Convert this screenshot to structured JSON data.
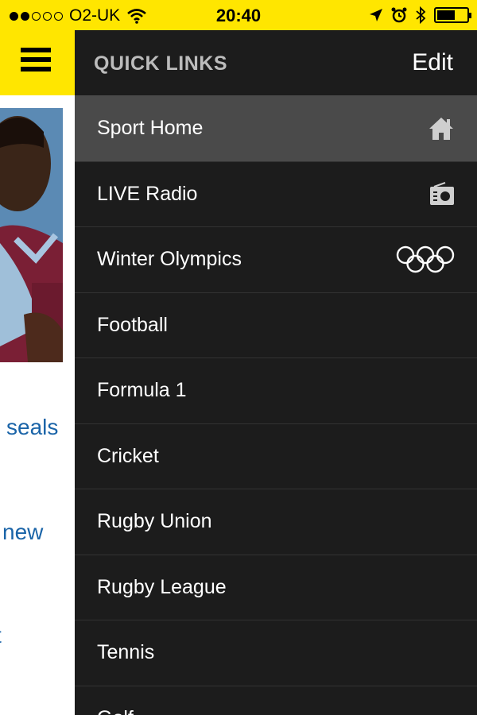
{
  "status_bar": {
    "carrier": "O2-UK",
    "time": "20:40",
    "signal_bars_filled": 2,
    "signal_bars_total": 5,
    "battery_level": 0.6
  },
  "drawer": {
    "title": "QUICK LINKS",
    "edit_label": "Edit",
    "items": [
      {
        "label": "Sport Home",
        "icon": "home-icon",
        "active": true
      },
      {
        "label": "LIVE Radio",
        "icon": "radio-icon"
      },
      {
        "label": "Winter Olympics",
        "icon": "olympic-rings-icon"
      },
      {
        "label": "Football"
      },
      {
        "label": "Formula 1"
      },
      {
        "label": "Cricket"
      },
      {
        "label": "Rugby Union"
      },
      {
        "label": "Rugby League"
      },
      {
        "label": "Tennis"
      },
      {
        "label": "Golf"
      }
    ]
  },
  "main": {
    "headlines": [
      "seals",
      "new",
      "t"
    ]
  },
  "colors": {
    "brand_yellow": "#ffe600",
    "drawer_bg": "#1c1c1c",
    "active_item_bg": "#4a4a4a",
    "link_blue": "#1a64a8"
  }
}
